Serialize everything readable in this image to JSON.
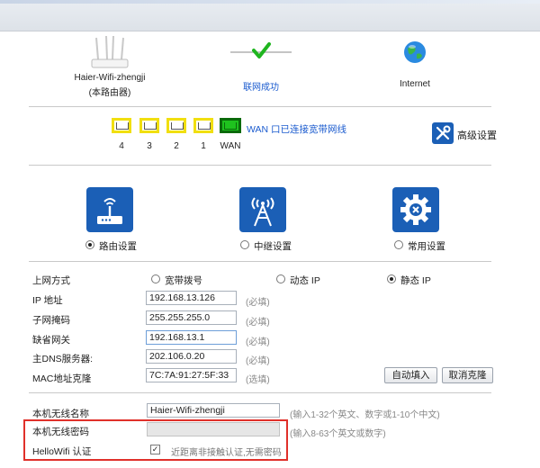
{
  "status": {
    "router_name": "Haier-Wifi-zhengji",
    "router_sub": "(本路由器)",
    "connection": "联网成功",
    "internet": "Internet"
  },
  "ports": {
    "labels": [
      "4",
      "3",
      "2",
      "1",
      "WAN"
    ],
    "wan_status": "WAN 口已连接宽带网线"
  },
  "advanced": {
    "label": "高级设置"
  },
  "modes": {
    "router": "路由设置",
    "repeater": "中继设置",
    "common": "常用设置",
    "selected": "router"
  },
  "internet_settings": {
    "label": "上网方式",
    "options": [
      "宽带拨号",
      "动态 IP",
      "静态 IP"
    ],
    "selected": "静态 IP"
  },
  "fields": {
    "ip": {
      "label": "IP 地址",
      "value": "192.168.13.126",
      "hint": "(必填)"
    },
    "mask": {
      "label": "子网掩码",
      "value": "255.255.255.0",
      "hint": "(必填)"
    },
    "gateway": {
      "label": "缺省网关",
      "value": "192.168.13.1",
      "hint": "(必填)"
    },
    "dns": {
      "label": "主DNS服务器:",
      "value": "202.106.0.20",
      "hint": "(必填)"
    },
    "mac": {
      "label": "MAC地址克隆",
      "value": "7C:7A:91:27:5F:33",
      "hint": "(选填)"
    }
  },
  "buttons": {
    "auto_fill": "自动填入",
    "cancel_clone": "取消克隆"
  },
  "wireless": {
    "ssid_label": "本机无线名称",
    "ssid_value": "Haier-Wifi-zhengji",
    "ssid_hint": "(输入1-32个英文、数字或1-10个中文)",
    "pwd_label": "本机无线密码",
    "pwd_value": "",
    "pwd_hint": "(输入8-63个英文或数字)",
    "auth_label": "HelloWifi 认证",
    "auth_checkbox": "✓",
    "auth_text": "近距离非接触认证,无需密码"
  },
  "colors": {
    "accent": "#1b5fb6",
    "link": "#1c5ccf",
    "port_border": "#f1df10",
    "wan_green": "#1ec21e",
    "highlight": "#e0302a"
  }
}
